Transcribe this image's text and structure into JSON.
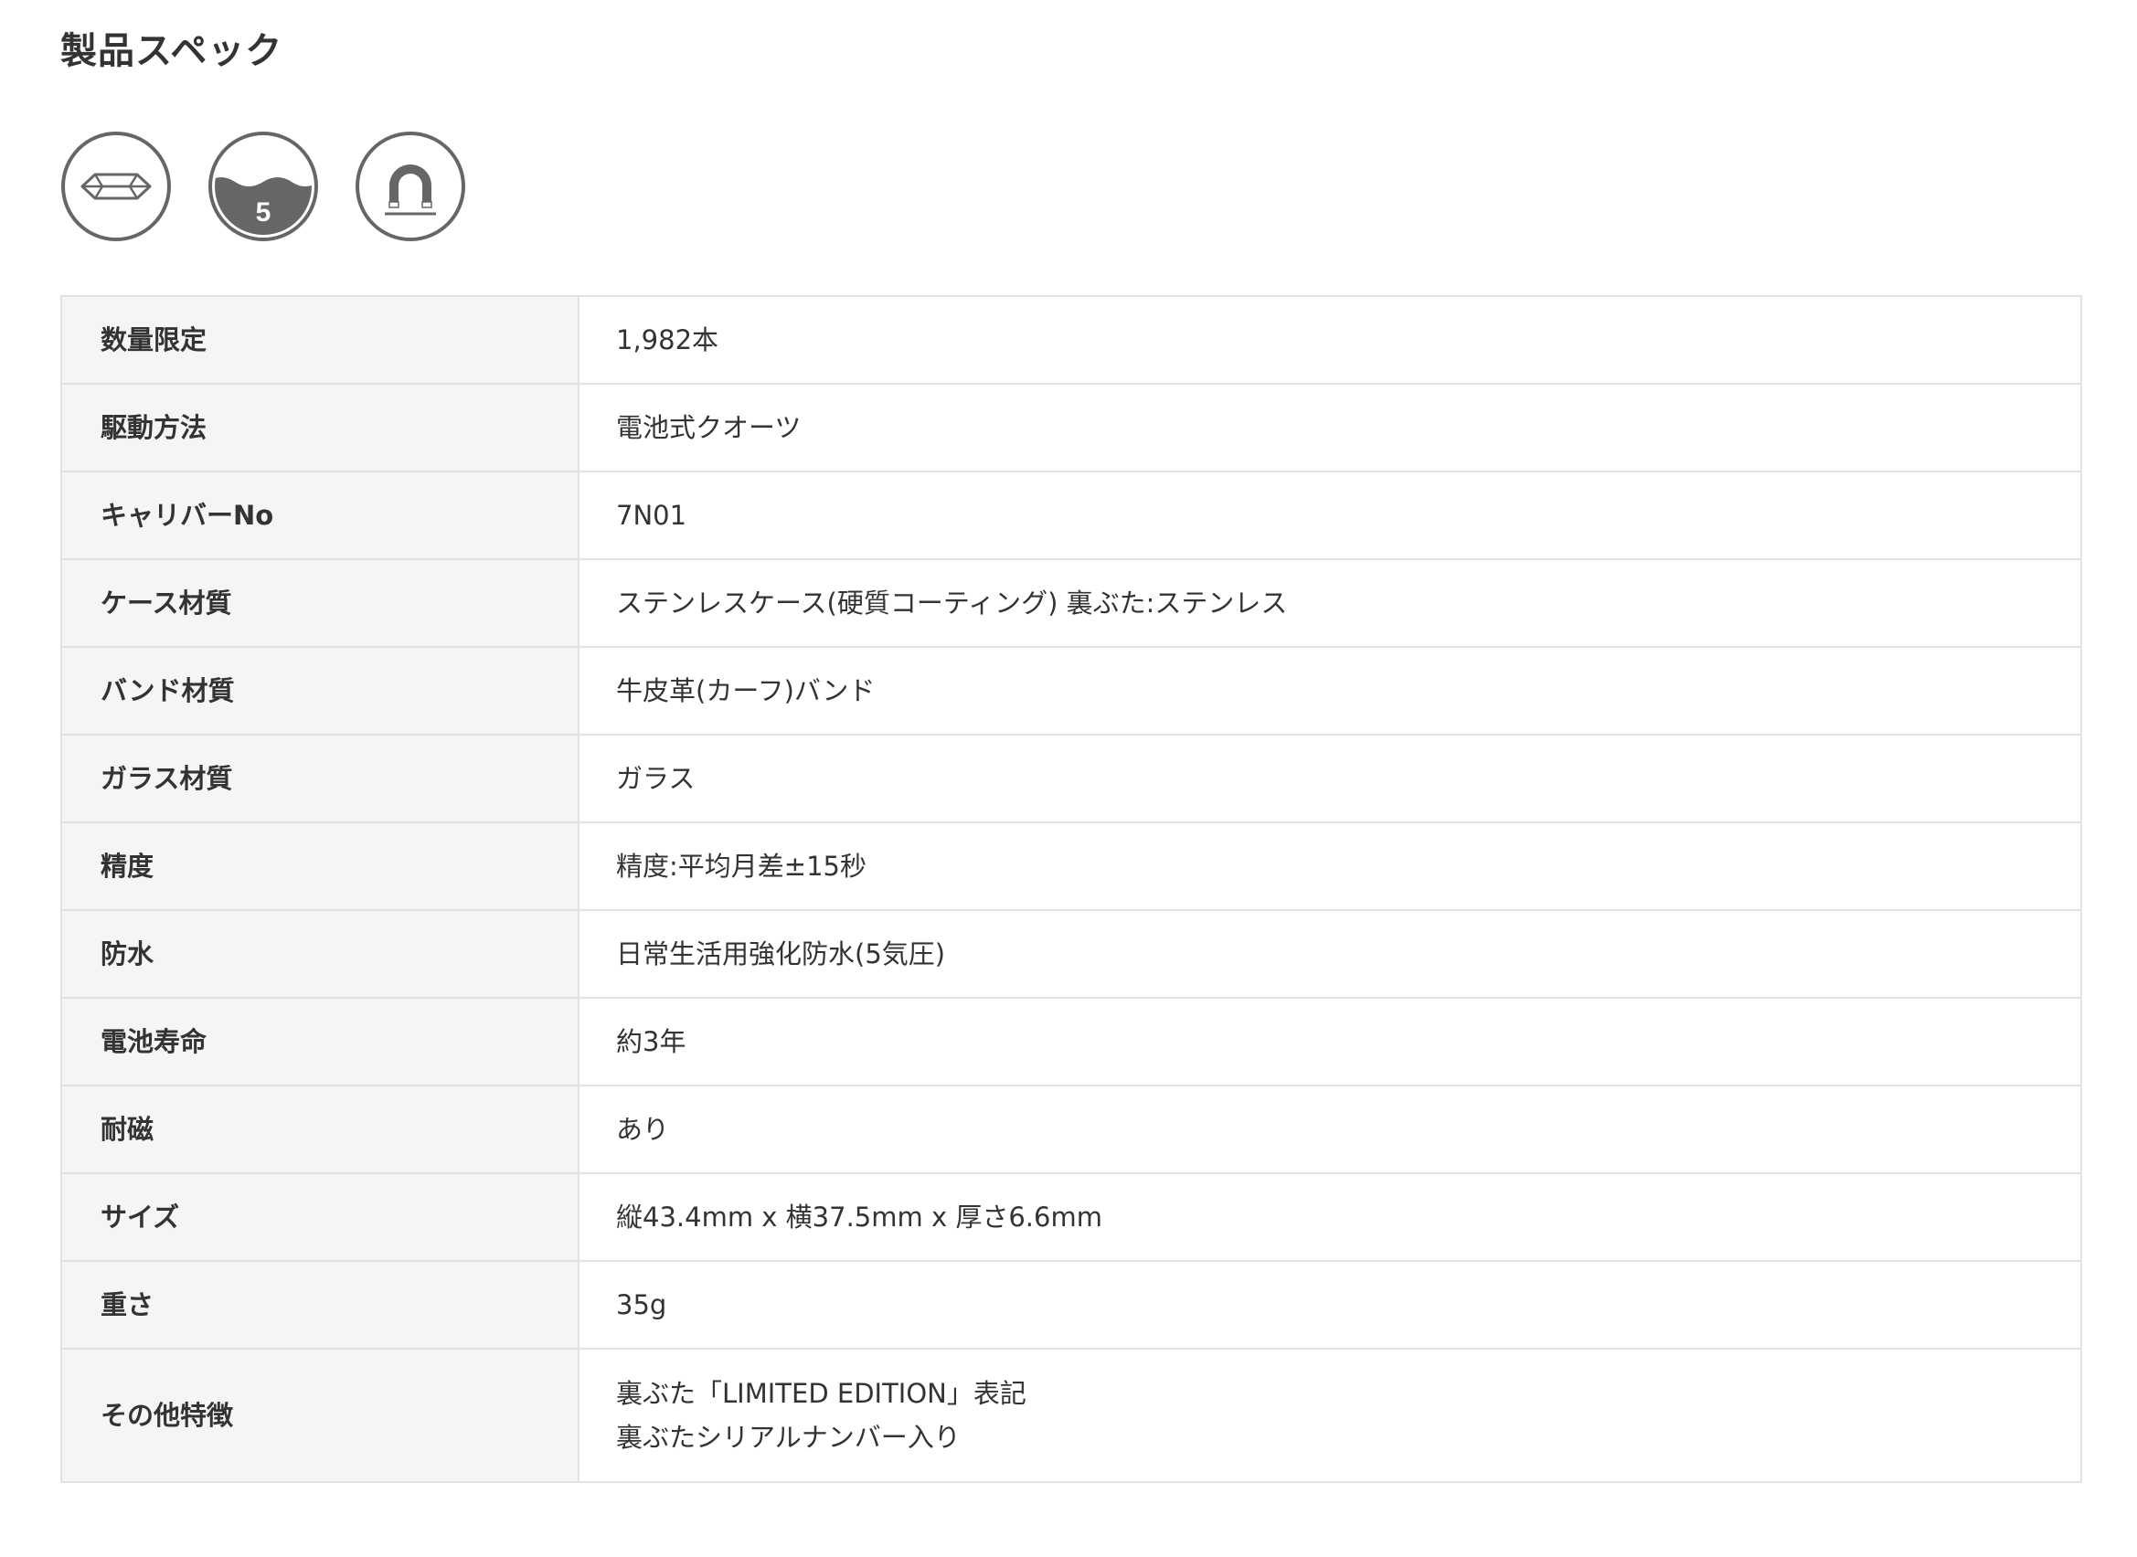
{
  "page_title": "製品スペック",
  "icons": [
    "sapphire-crystal-icon",
    "water-resistant-5-bar-icon",
    "magnetic-resistant-icon"
  ],
  "water_resistance_badge": "5",
  "specs": [
    {
      "label": "数量限定",
      "value": "1,982本"
    },
    {
      "label": "駆動方法",
      "value": "電池式クオーツ"
    },
    {
      "label": "キャリバーNo",
      "value": "7N01"
    },
    {
      "label": "ケース材質",
      "value": "ステンレスケース(硬質コーティング) 裏ぶた:ステンレス"
    },
    {
      "label": "バンド材質",
      "value": "牛皮革(カーフ)バンド"
    },
    {
      "label": "ガラス材質",
      "value": "ガラス"
    },
    {
      "label": "精度",
      "value": "精度:平均月差±15秒"
    },
    {
      "label": "防水",
      "value": "日常生活用強化防水(5気圧)"
    },
    {
      "label": "電池寿命",
      "value": "約3年"
    },
    {
      "label": "耐磁",
      "value": "あり"
    },
    {
      "label": "サイズ",
      "value": "縦43.4mm x 横37.5mm x 厚さ6.6mm"
    },
    {
      "label": "重さ",
      "value": "35g"
    },
    {
      "label": "その他特徴",
      "value_lines": [
        "裏ぶた「LIMITED EDITION」表記",
        "裏ぶたシリアルナンバー入り"
      ]
    }
  ],
  "colors": {
    "text": "#333333",
    "label_bg": "#f5f5f5",
    "border": "#e2e2e2",
    "icon": "#666666"
  }
}
